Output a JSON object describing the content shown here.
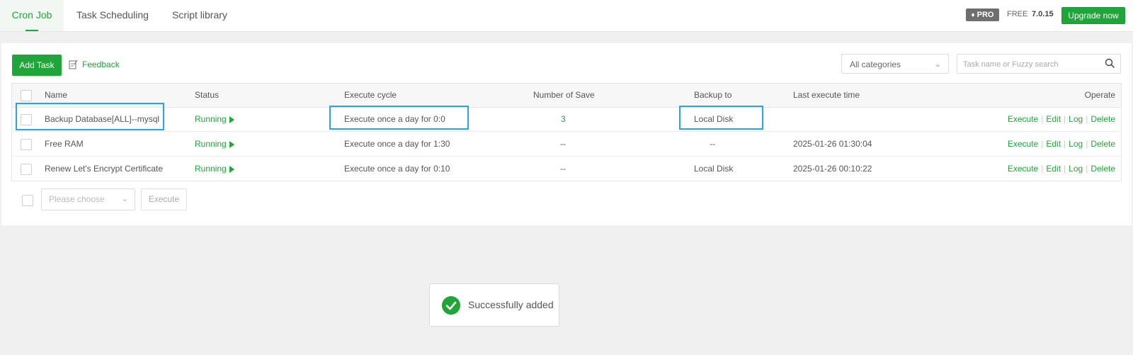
{
  "tabs": [
    {
      "label": "Cron Job",
      "active": true
    },
    {
      "label": "Task Scheduling",
      "active": false
    },
    {
      "label": "Script library",
      "active": false
    }
  ],
  "header": {
    "pro_label": "PRO",
    "free_label": "FREE",
    "version": "7.0.15",
    "upgrade_label": "Upgrade now"
  },
  "toolbar": {
    "add_task_label": "Add Task",
    "feedback_label": "Feedback",
    "category_select_value": "All categories",
    "search_placeholder": "Task name or Fuzzy search"
  },
  "table": {
    "columns": [
      "Name",
      "Status",
      "Execute cycle",
      "Number of Save",
      "Backup to",
      "Last execute time",
      "Operate"
    ],
    "rows": [
      {
        "name": "Backup Database[ALL]--mysql",
        "status": "Running",
        "cycle": "Execute once a day for 0:0",
        "saves": "3",
        "backup": "Local Disk",
        "last_time": ""
      },
      {
        "name": "Free RAM",
        "status": "Running",
        "cycle": "Execute once a day for 1:30",
        "saves": "--",
        "backup": "--",
        "last_time": "2025-01-26 01:30:04"
      },
      {
        "name": "Renew Let's Encrypt Certificate",
        "status": "Running",
        "cycle": "Execute once a day for 0:10",
        "saves": "--",
        "backup": "Local Disk",
        "last_time": "2025-01-26 00:10:22"
      }
    ],
    "operations": [
      "Execute",
      "Edit",
      "Log",
      "Delete"
    ]
  },
  "batch": {
    "select_placeholder": "Please choose",
    "execute_label": "Execute"
  },
  "toast": {
    "message": "Successfully added"
  },
  "colors": {
    "accent": "#20a53a",
    "highlight": "#2aa3ef"
  }
}
